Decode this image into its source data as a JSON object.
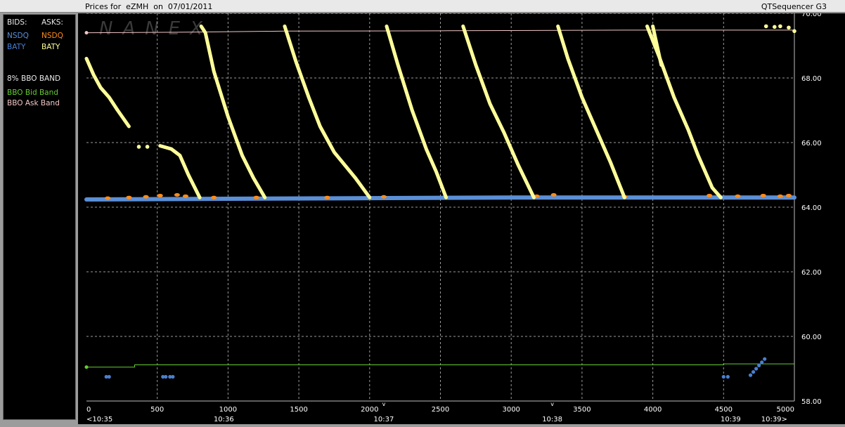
{
  "window": {
    "title_left": "Prices for  eZMH  on  07/01/2011",
    "title_right": "QTSequencer G3"
  },
  "legend": {
    "bids_header": "BIDS:",
    "asks_header": "ASKS:",
    "bid_nsdq": "NSDQ",
    "ask_nsdq": "NSDQ",
    "bid_baty": "BATY",
    "ask_baty": "BATY",
    "band_title": "8% BBO BAND",
    "bid_band": "BBO Bid Band",
    "ask_band": "BBO Ask Band"
  },
  "colors": {
    "nsdq_bid": "#5b8fd6",
    "nsdq_ask": "#ff8c1a",
    "baty_bid": "#4a7fd0",
    "baty_ask": "#ffff99",
    "bid_band": "#66cc33",
    "ask_band": "#f2c6c6",
    "grid": "#9a9a9a",
    "axis_text": "#ffffff"
  },
  "watermark": "NANEX",
  "chart_data": {
    "type": "scatter",
    "title": "Prices for  eZMH  on  07/01/2011",
    "xlabel": "",
    "ylabel": "",
    "xlim": [
      0,
      5000
    ],
    "ylim": [
      58.0,
      70.0
    ],
    "grid": true,
    "legend_position": "left panel",
    "x_ticks": [
      0,
      500,
      1000,
      1500,
      2000,
      2500,
      3000,
      3500,
      4000,
      4500,
      5000
    ],
    "x_tick_labels": [
      "0",
      "500",
      "1000",
      "1500",
      "2000",
      "2500",
      "3000",
      "3500",
      "4000",
      "4500",
      "5000"
    ],
    "y_ticks": [
      58,
      60,
      62,
      64,
      66,
      68,
      70
    ],
    "y_tick_labels": [
      "58.00",
      "60.00",
      "62.00",
      "64.00",
      "66.00",
      "68.00",
      "70.00"
    ],
    "time_labels": [
      {
        "x": 0,
        "label": "<10:35"
      },
      {
        "x": 970,
        "label": "10:36"
      },
      {
        "x": 2100,
        "label": "10:37"
      },
      {
        "x": 3290,
        "label": "10:38"
      },
      {
        "x": 4550,
        "label": "10:39"
      },
      {
        "x": 4950,
        "label": "10:39>"
      }
    ],
    "minute_markers": [
      2100,
      3290
    ],
    "series": [
      {
        "name": "NSDQ",
        "role": "bid",
        "kind": "flat",
        "segments": [
          [
            0,
            64.24
          ],
          [
            1000,
            64.26
          ],
          [
            2000,
            64.28
          ],
          [
            3000,
            64.3
          ],
          [
            4000,
            64.3
          ],
          [
            5000,
            64.3
          ]
        ]
      },
      {
        "name": "NSDQ",
        "role": "ask",
        "kind": "points",
        "points": [
          [
            150,
            64.28
          ],
          [
            300,
            64.3
          ],
          [
            420,
            64.32
          ],
          [
            520,
            64.36
          ],
          [
            640,
            64.38
          ],
          [
            700,
            64.34
          ],
          [
            900,
            64.3
          ],
          [
            1200,
            64.3
          ],
          [
            1700,
            64.3
          ],
          [
            2100,
            64.32
          ],
          [
            3180,
            64.34
          ],
          [
            3300,
            64.38
          ],
          [
            3800,
            64.32
          ],
          [
            4400,
            64.36
          ],
          [
            4600,
            64.34
          ],
          [
            4780,
            64.36
          ],
          [
            4900,
            64.34
          ],
          [
            4960,
            64.36
          ]
        ]
      },
      {
        "name": "BATY",
        "role": "bid",
        "kind": "points",
        "points": [
          [
            140,
            58.75
          ],
          [
            160,
            58.75
          ],
          [
            540,
            58.75
          ],
          [
            560,
            58.75
          ],
          [
            590,
            58.75
          ],
          [
            610,
            58.75
          ],
          [
            4500,
            58.75
          ],
          [
            4530,
            58.75
          ],
          [
            4690,
            58.8
          ],
          [
            4710,
            58.9
          ],
          [
            4730,
            59.0
          ],
          [
            4750,
            59.1
          ],
          [
            4770,
            59.2
          ],
          [
            4790,
            59.3
          ]
        ]
      },
      {
        "name": "BATY",
        "role": "ask",
        "kind": "segments",
        "lines": [
          [
            [
              0,
              68.6
            ],
            [
              50,
              68.1
            ],
            [
              100,
              67.7
            ],
            [
              160,
              67.4
            ],
            [
              220,
              67.0
            ],
            [
              300,
              66.5
            ]
          ],
          [
            [
              520,
              65.9
            ],
            [
              600,
              65.8
            ],
            [
              660,
              65.6
            ],
            [
              720,
              65.0
            ],
            [
              800,
              64.3
            ]
          ],
          [
            [
              810,
              69.6
            ],
            [
              840,
              69.4
            ],
            [
              900,
              68.2
            ],
            [
              1000,
              66.8
            ],
            [
              1100,
              65.6
            ],
            [
              1180,
              64.9
            ],
            [
              1260,
              64.3
            ]
          ],
          [
            [
              1400,
              69.6
            ],
            [
              1480,
              68.5
            ],
            [
              1570,
              67.4
            ],
            [
              1650,
              66.5
            ],
            [
              1750,
              65.7
            ],
            [
              1900,
              64.9
            ],
            [
              2000,
              64.3
            ]
          ],
          [
            [
              2120,
              69.6
            ],
            [
              2200,
              68.4
            ],
            [
              2300,
              67.0
            ],
            [
              2400,
              65.8
            ],
            [
              2470,
              65.1
            ],
            [
              2540,
              64.3
            ]
          ],
          [
            [
              2660,
              69.6
            ],
            [
              2750,
              68.4
            ],
            [
              2850,
              67.2
            ],
            [
              2950,
              66.3
            ],
            [
              3050,
              65.3
            ],
            [
              3160,
              64.3
            ]
          ],
          [
            [
              3330,
              69.6
            ],
            [
              3400,
              68.6
            ],
            [
              3500,
              67.4
            ],
            [
              3600,
              66.4
            ],
            [
              3700,
              65.4
            ],
            [
              3800,
              64.3
            ]
          ],
          [
            [
              3960,
              69.6
            ],
            [
              4050,
              68.6
            ],
            [
              4150,
              67.4
            ],
            [
              4250,
              66.4
            ],
            [
              4320,
              65.6
            ],
            [
              4420,
              64.6
            ],
            [
              4480,
              64.3
            ]
          ],
          [
            [
              4000,
              69.6
            ],
            [
              4060,
              68.4
            ]
          ]
        ],
        "isolated": [
          [
            370,
            65.87
          ],
          [
            430,
            65.87
          ],
          [
            4800,
            69.6
          ],
          [
            4860,
            69.58
          ],
          [
            4900,
            69.6
          ],
          [
            4960,
            69.56
          ],
          [
            5000,
            69.45
          ]
        ]
      },
      {
        "name": "BBO Bid Band",
        "role": "band",
        "kind": "step",
        "points": [
          [
            0,
            59.05
          ],
          [
            340,
            59.05
          ],
          [
            340,
            59.12
          ],
          [
            4500,
            59.12
          ],
          [
            4500,
            59.15
          ],
          [
            5000,
            59.15
          ]
        ]
      },
      {
        "name": "BBO Ask Band",
        "role": "band",
        "kind": "step",
        "points": [
          [
            0,
            69.4
          ],
          [
            800,
            69.42
          ],
          [
            1400,
            69.45
          ],
          [
            2500,
            69.46
          ],
          [
            3800,
            69.48
          ],
          [
            5000,
            69.48
          ]
        ]
      }
    ]
  }
}
